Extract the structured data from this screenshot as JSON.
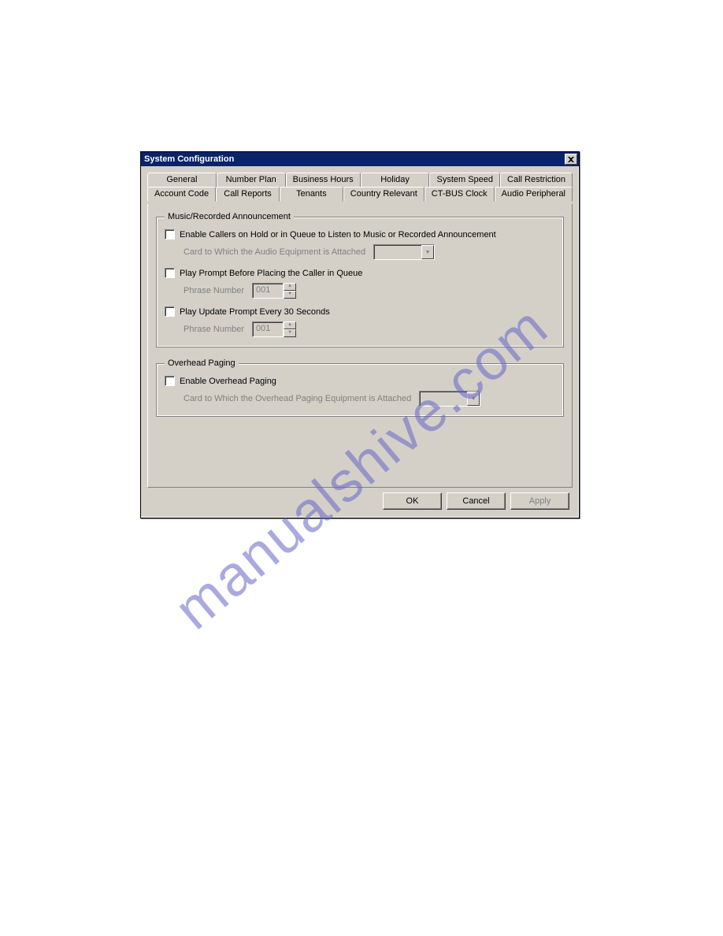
{
  "watermark": "manualshive.com",
  "titlebar": {
    "title": "System Configuration"
  },
  "tabs": {
    "row1": [
      "General",
      "Number Plan",
      "Business Hours",
      "Holiday",
      "System Speed",
      "Call Restriction"
    ],
    "row2": [
      "Account Code",
      "Call Reports",
      "Tenants",
      "Country Relevant",
      "CT-BUS Clock",
      "Audio Peripheral"
    ],
    "active": "Audio Peripheral"
  },
  "group1": {
    "legend": "Music/Recorded Announcement",
    "cb1": "Enable Callers on Hold or in Queue to Listen to Music or Recorded Announcement",
    "sub1": "Card to Which the Audio Equipment is Attached",
    "cb2": "Play Prompt Before Placing the Caller in Queue",
    "sub2": "Phrase Number",
    "phrase2": "001",
    "cb3": "Play Update Prompt Every 30 Seconds",
    "sub3": "Phrase Number",
    "phrase3": "001"
  },
  "group2": {
    "legend": "Overhead Paging",
    "cb1": "Enable Overhead Paging",
    "sub1": "Card to Which the Overhead Paging Equipment is Attached"
  },
  "buttons": {
    "ok": "OK",
    "cancel": "Cancel",
    "apply": "Apply"
  }
}
